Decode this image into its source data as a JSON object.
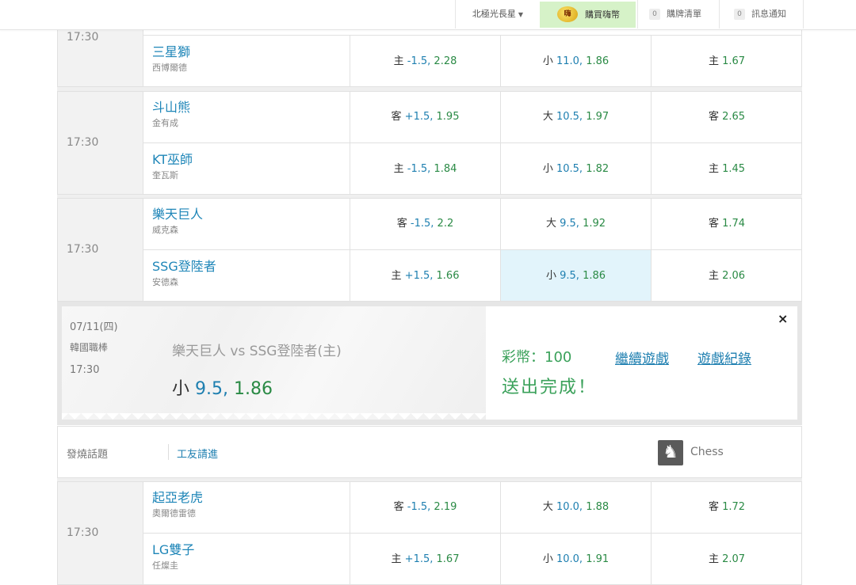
{
  "topbar": {
    "user_name": "北極光長星",
    "buy_coins_label": "購買嗨幣",
    "coin_badge": "嗨",
    "cart_count": "0",
    "cart_label": "購牌清單",
    "notify_count": "0",
    "notify_label": "訊息通知"
  },
  "games": [
    {
      "time": "17:30",
      "rows": [
        {
          "team": "三星獅",
          "pitcher": "西博爾德",
          "handicap_k": "主",
          "handicap_spread": "-1.5,",
          "handicap_odds": "2.28",
          "total_k": "小",
          "total_spread": "11.0,",
          "total_odds": "1.86",
          "ml_k": "主",
          "ml_odds": "1.67"
        }
      ]
    },
    {
      "time": "17:30",
      "rows": [
        {
          "team": "斗山熊",
          "pitcher": "金有成",
          "handicap_k": "客",
          "handicap_spread": "+1.5,",
          "handicap_odds": "1.95",
          "total_k": "大",
          "total_spread": "10.5,",
          "total_odds": "1.97",
          "ml_k": "客",
          "ml_odds": "2.65"
        },
        {
          "team": "KT巫師",
          "pitcher": "奎瓦斯",
          "handicap_k": "主",
          "handicap_spread": "-1.5,",
          "handicap_odds": "1.84",
          "total_k": "小",
          "total_spread": "10.5,",
          "total_odds": "1.82",
          "ml_k": "主",
          "ml_odds": "1.45"
        }
      ]
    },
    {
      "time": "17:30",
      "rows": [
        {
          "team": "樂天巨人",
          "pitcher": "威克森",
          "handicap_k": "客",
          "handicap_spread": "-1.5,",
          "handicap_odds": "2.2",
          "total_k": "大",
          "total_spread": "9.5,",
          "total_odds": "1.92",
          "ml_k": "客",
          "ml_odds": "1.74"
        },
        {
          "team": "SSG登陸者",
          "pitcher": "安德森",
          "handicap_k": "主",
          "handicap_spread": "+1.5,",
          "handicap_odds": "1.66",
          "total_k": "小",
          "total_spread": "9.5,",
          "total_odds": "1.86",
          "ml_k": "主",
          "ml_odds": "2.06"
        }
      ]
    },
    {
      "time": "17:30",
      "rows": [
        {
          "team": "起亞老虎",
          "pitcher": "奧爾德雷德",
          "handicap_k": "客",
          "handicap_spread": "-1.5,",
          "handicap_odds": "2.19",
          "total_k": "大",
          "total_spread": "10.0,",
          "total_odds": "1.88",
          "ml_k": "客",
          "ml_odds": "1.72"
        },
        {
          "team": "LG雙子",
          "pitcher": "任燦圭",
          "handicap_k": "主",
          "handicap_spread": "+1.5,",
          "handicap_odds": "1.67",
          "total_k": "小",
          "total_spread": "10.0,",
          "total_odds": "1.91",
          "ml_k": "主",
          "ml_odds": "2.07"
        }
      ]
    }
  ],
  "confirm": {
    "date": "07/11(四)",
    "league": "韓國職棒",
    "time": "17:30",
    "matchup": "樂天巨人 vs SSG登陸者(主)",
    "pick_k": "小",
    "pick_spread": "9.5,",
    "pick_odds": "1.86",
    "coins": "彩幣：100",
    "done": "送出完成！",
    "continue_label": "繼續遊戲",
    "history_label": "遊戲紀錄",
    "close": "×"
  },
  "topic": {
    "label": "發燒話題",
    "link": "工友請進",
    "chess_label": "Chess"
  }
}
